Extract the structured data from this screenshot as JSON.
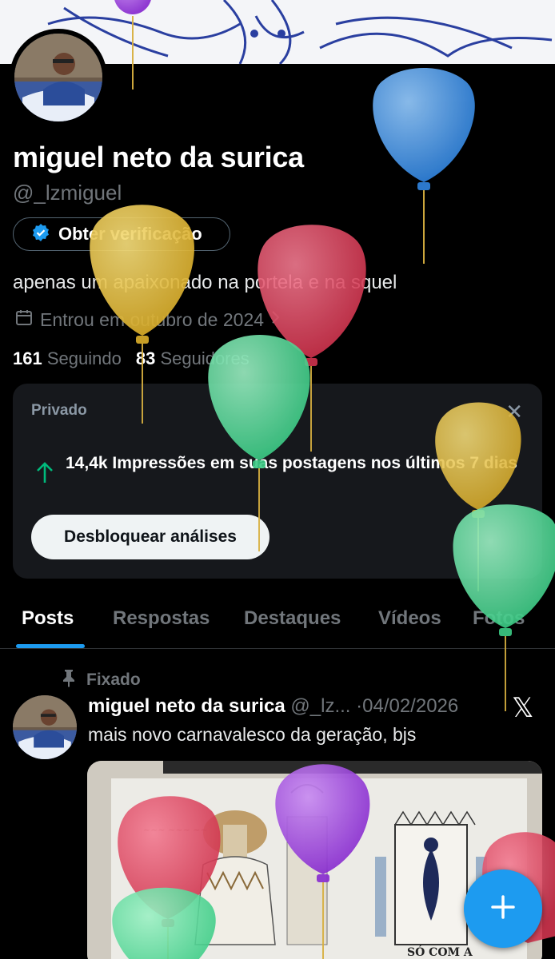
{
  "profile": {
    "name": "miguel neto da surica",
    "handle": "@_lzmiguel",
    "verify_label": "Obter verificação",
    "bio": "apenas um apaixonado na portela e na squel",
    "joined": "Entrou em outubro de 2024",
    "following_count": "161",
    "following_label": "Seguindo",
    "followers_count": "83",
    "followers_label": "Seguidores"
  },
  "analytics_card": {
    "private_label": "Privado",
    "impressions_text": "14,4k Impressões em suas postagens nos últimos 7 dias",
    "unlock_label": "Desbloquear análises"
  },
  "tabs": [
    {
      "label": "Posts",
      "active": true
    },
    {
      "label": "Respostas",
      "active": false
    },
    {
      "label": "Destaques",
      "active": false
    },
    {
      "label": "Vídeos",
      "active": false
    },
    {
      "label": "Fotos",
      "active": false
    }
  ],
  "pinned_post": {
    "pinned_label": "Fixado",
    "author_name": "miguel neto da surica",
    "author_handle": "@_lz...",
    "date": "04/02/2026",
    "text": "mais novo carnavalesco da geração, bjs"
  },
  "image_texts": {
    "stamp": "SÓ COM A"
  },
  "icons": [
    "verified-badge-icon",
    "calendar-icon",
    "chevron-right-icon",
    "close-icon",
    "arrow-up-icon",
    "pin-icon",
    "x-logo-icon",
    "plus-icon"
  ],
  "colors": {
    "background": "#000000",
    "accent": "#1d9bf0",
    "muted": "#71767b",
    "growth": "#00ba7c",
    "card": "#16181c"
  }
}
